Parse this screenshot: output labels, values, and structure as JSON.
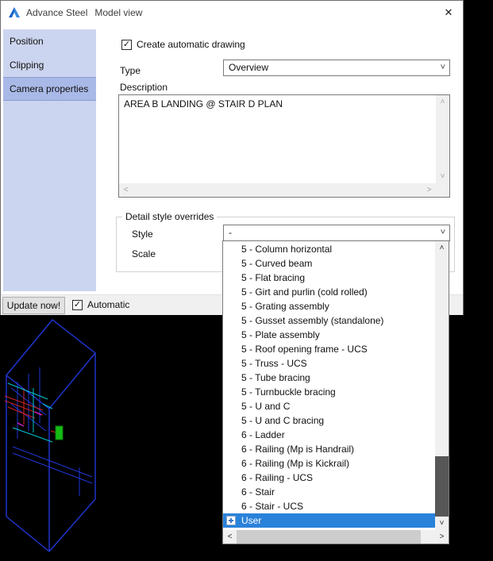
{
  "window": {
    "title_app": "Advance Steel",
    "title_doc": "Model view"
  },
  "sidebar": {
    "items": [
      {
        "label": "Position",
        "selected": false
      },
      {
        "label": "Clipping",
        "selected": false
      },
      {
        "label": "Camera properties",
        "selected": true
      }
    ]
  },
  "form": {
    "create_drawing": {
      "label": "Create automatic drawing",
      "checked": true
    },
    "type": {
      "label": "Type",
      "value": "Overview"
    },
    "description": {
      "label": "Description",
      "value": "AREA B LANDING @ STAIR D PLAN"
    },
    "detail_overrides": {
      "group_title": "Detail style overrides",
      "style": {
        "label": "Style",
        "value": "-"
      },
      "scale": {
        "label": "Scale"
      }
    }
  },
  "footer": {
    "update_button": "Update now!",
    "automatic": {
      "label": "Automatic",
      "checked": true
    }
  },
  "style_dropdown": {
    "selected_item": "User",
    "items": [
      {
        "label": "5 - Column horizontal"
      },
      {
        "label": "5 - Curved beam"
      },
      {
        "label": "5 - Flat bracing"
      },
      {
        "label": "5 - Girt and purlin (cold rolled)"
      },
      {
        "label": "5 - Grating assembly"
      },
      {
        "label": "5 - Gusset assembly (standalone)"
      },
      {
        "label": "5 - Plate assembly"
      },
      {
        "label": "5 - Roof opening frame - UCS"
      },
      {
        "label": "5 - Truss - UCS"
      },
      {
        "label": "5 - Tube bracing"
      },
      {
        "label": "5 - Turnbuckle bracing"
      },
      {
        "label": "5 - U and C"
      },
      {
        "label": "5 - U and C bracing"
      },
      {
        "label": "6 - Ladder"
      },
      {
        "label": "6 - Railing (Mp is Handrail)"
      },
      {
        "label": "6 - Railing (Mp is Kickrail)"
      },
      {
        "label": "6 - Railing - UCS"
      },
      {
        "label": "6 - Stair"
      },
      {
        "label": "6 - Stair - UCS"
      },
      {
        "label": "User",
        "selected": true,
        "icon": "user-style-icon"
      }
    ]
  },
  "icons": {
    "close": "✕",
    "check": "✓",
    "dropdown_arrow": "˅",
    "scroll_up": "˄",
    "scroll_down": "˅",
    "scroll_left": "˂",
    "scroll_right": "˃"
  },
  "colors": {
    "selection_blue": "#2a82da",
    "sidebar_bg": "#ccd5ef",
    "sidebar_selected_bg": "#a9b9e7",
    "footer_bg": "#f0f0f0",
    "scroll_thumb_dark": "#575757",
    "cad_blue": "#2036d6",
    "cad_red": "#d42222",
    "cad_cyan": "#00c6d6",
    "cad_green": "#16bb16",
    "cad_magenta": "#cc22cc"
  }
}
